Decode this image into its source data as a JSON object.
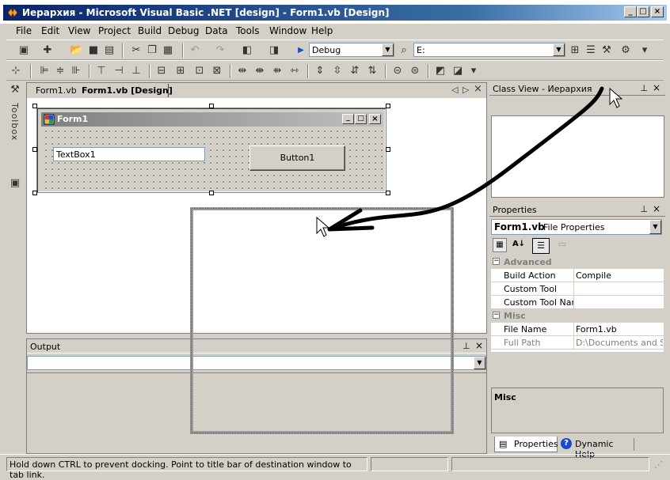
{
  "window": {
    "title": "Иерархия - Microsoft Visual Basic .NET [design] - Form1.vb [Design]",
    "minimize_glyph": "_",
    "maximize_glyph": "□",
    "close_glyph": "×"
  },
  "menu": [
    "File",
    "Edit",
    "View",
    "Project",
    "Build",
    "Debug",
    "Data",
    "Tools",
    "Window",
    "Help"
  ],
  "toolbar": {
    "config_value": "Debug",
    "find_value": "E:"
  },
  "toolbox": {
    "label": "Toolbox"
  },
  "editor": {
    "tabs": [
      "Form1.vb",
      "Form1.vb [Design]"
    ],
    "active_tab": 1,
    "nav": {
      "left": "◁",
      "right": "▷",
      "close": "×"
    }
  },
  "form": {
    "caption": "Form1",
    "textbox_text": "TextBox1",
    "button_label": "Button1"
  },
  "output": {
    "title": "Output"
  },
  "class_view": {
    "title": "Class View - Иерархия"
  },
  "properties": {
    "title": "Properties",
    "selected_name": "Form1.vb",
    "selected_type": "File Properties",
    "categories": [
      {
        "name": "Advanced",
        "rows": [
          {
            "key": "Build Action",
            "value": "Compile"
          },
          {
            "key": "Custom Tool",
            "value": ""
          },
          {
            "key": "Custom Tool Name",
            "value": ""
          }
        ]
      },
      {
        "name": "Misc",
        "rows": [
          {
            "key": "File Name",
            "value": "Form1.vb"
          },
          {
            "key": "Full Path",
            "value": "D:\\Documents and Setting"
          }
        ]
      }
    ],
    "description_title": "Misc",
    "tabs": [
      "Properties",
      "Dynamic Help"
    ]
  },
  "status": {
    "message": "Hold down CTRL to prevent docking.  Point to title bar of destination window to tab link."
  }
}
